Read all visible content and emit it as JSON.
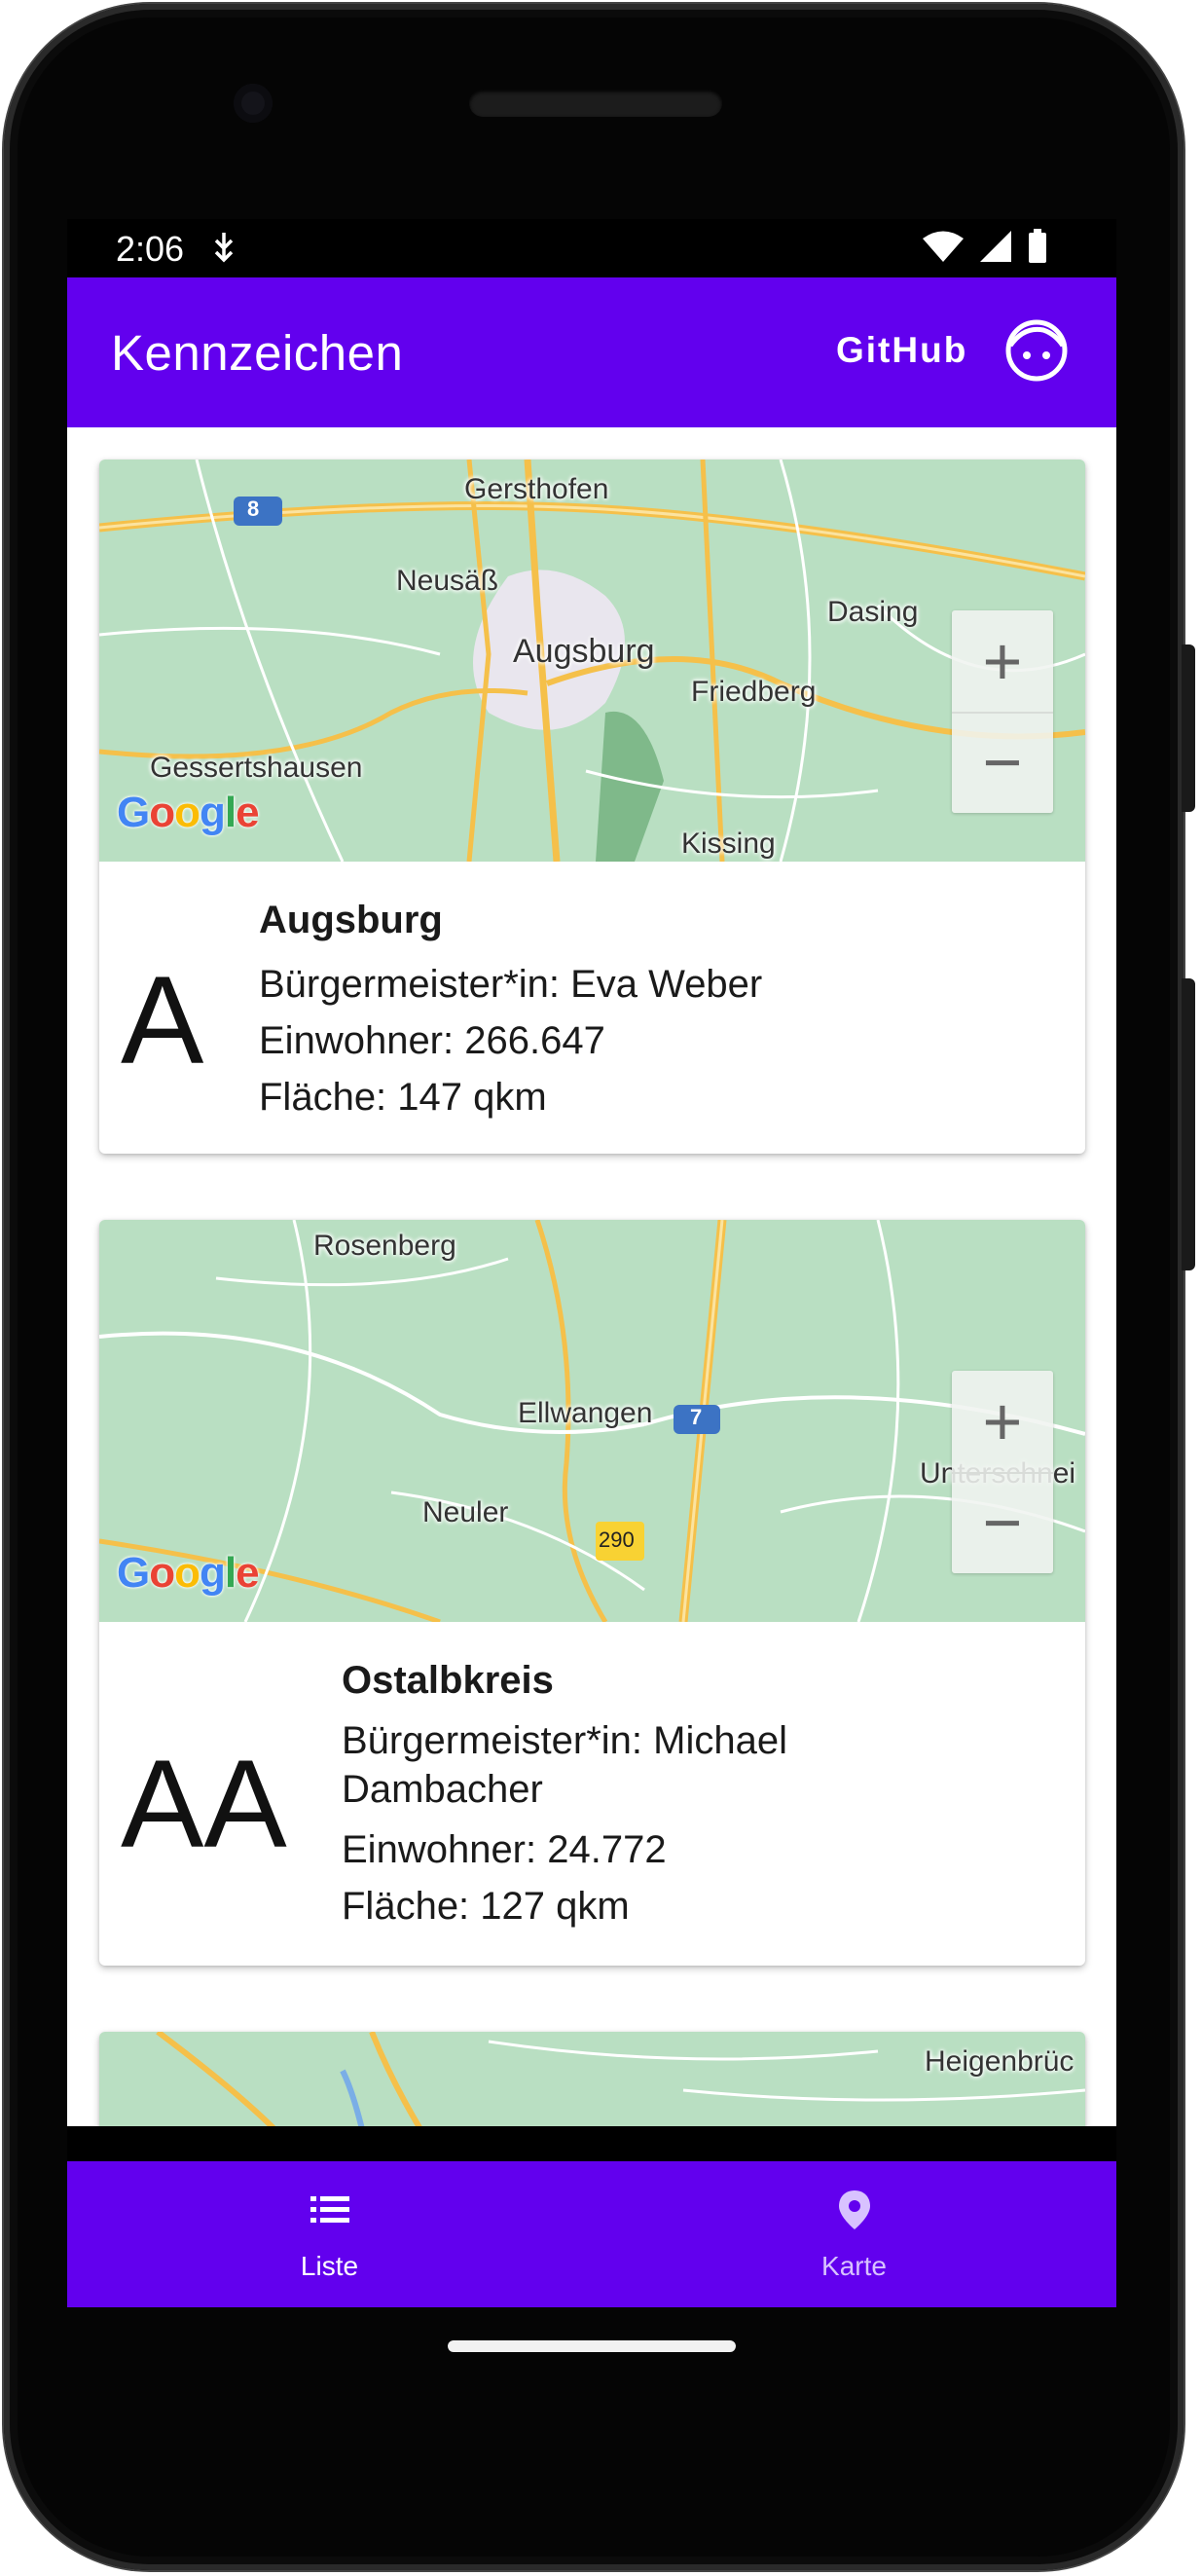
{
  "status": {
    "time": "2:06"
  },
  "app_bar": {
    "title": "Kennzeichen",
    "github_label": "GitHub"
  },
  "cards": [
    {
      "plate": "A",
      "name": "Augsburg",
      "mayor": "Bürgermeister*in: Eva Weber",
      "population": "Einwohner: 266.647",
      "area": "Fläche: 147 qkm",
      "map_labels": [
        "Gersthofen",
        "Neusäß",
        "Augsburg",
        "Dasing",
        "Friedberg",
        "Gessertshausen",
        "Kissing"
      ],
      "road_shield": "8"
    },
    {
      "plate": "AA",
      "name": "Ostalbkreis",
      "mayor_line1": "Bürgermeister*in: Michael",
      "mayor_line2": "Dambacher",
      "population": "Einwohner: 24.772",
      "area": "Fläche: 127 qkm",
      "map_labels": [
        "Rosenberg",
        "Ellwangen",
        "Neuler",
        "Unterschnei"
      ],
      "road_shield": "7",
      "road_badge": "290"
    },
    {
      "map_labels": [
        "Heigenbrüc"
      ]
    }
  ],
  "map_controls": {
    "zoom_in": "+",
    "zoom_out": "−",
    "google": [
      "G",
      "o",
      "o",
      "g",
      "l",
      "e"
    ]
  },
  "bottom_nav": {
    "list_label": "Liste",
    "map_label": "Karte"
  },
  "colors": {
    "primary": "#6200ee",
    "map_base": "#b9dfc2",
    "road": "#f5c04a"
  }
}
